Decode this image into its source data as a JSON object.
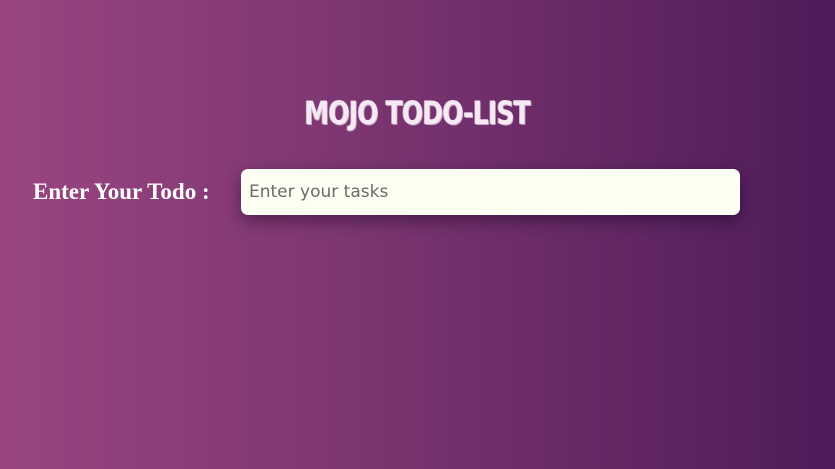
{
  "header": {
    "title": "MOJO TODO-LIST"
  },
  "todo_form": {
    "label": "Enter Your Todo :",
    "input_placeholder": "Enter your tasks",
    "input_value": ""
  },
  "colors": {
    "background_start": "#9a4580",
    "background_end": "#4f1b5a",
    "input_background": "#fdfff2",
    "text": "#ffffff"
  }
}
